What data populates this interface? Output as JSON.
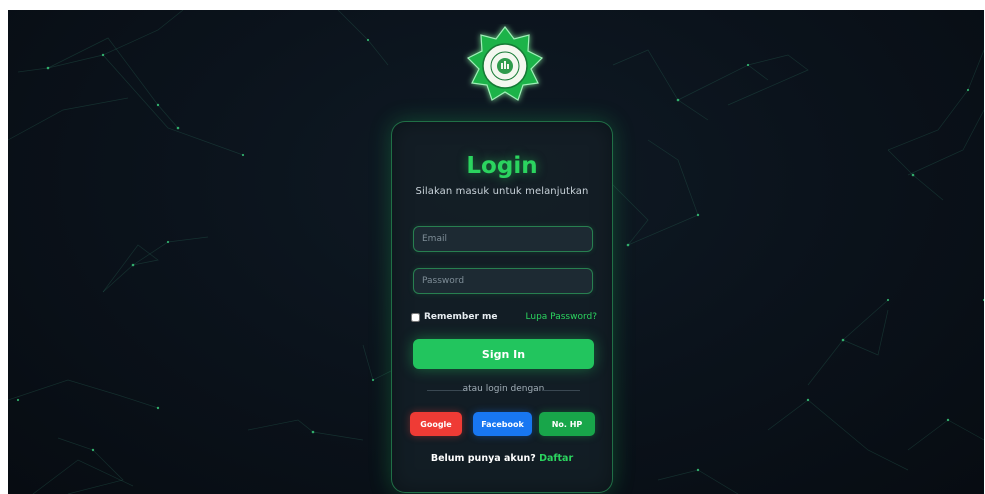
{
  "colors": {
    "background": "#0b131c",
    "accent": "#22c55e",
    "google": "#ef3b35",
    "facebook": "#1877f2",
    "phone": "#18a64a"
  },
  "logo": {
    "icon": "institution-seal-icon"
  },
  "login": {
    "title": "Login",
    "subtitle": "Silakan masuk untuk melanjutkan",
    "email_placeholder": "Email",
    "password_placeholder": "Password",
    "remember_label": "Remember me",
    "forgot_label": "Lupa Password?",
    "signin_label": "Sign In",
    "divider_text": "atau login dengan",
    "social": {
      "google": "Google",
      "facebook": "Facebook",
      "phone": "No. HP"
    },
    "signup_prompt": "Belum punya akun?",
    "signup_link": "Daftar"
  }
}
